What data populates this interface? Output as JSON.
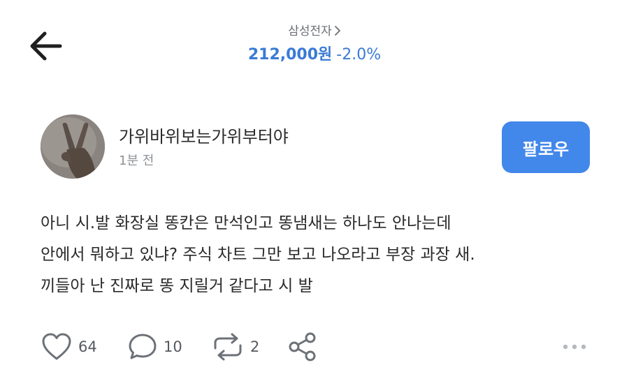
{
  "header": {
    "back_icon": "arrow-left-icon",
    "stock_name": "삼성전자",
    "stock_name_chevron": "chevron-right-icon",
    "price": "212,000원",
    "change": "-2.0%",
    "price_color": "#3a7bd5"
  },
  "post": {
    "author": "가위바위보는가위부터야",
    "time": "1분 전",
    "follow_label": "팔로우",
    "follow_color": "#4287ea",
    "body_lines": [
      "아니 시.발 화장실 똥칸은 만석인고 똥냄새는 하나도 안나는데",
      "안에서 뭐하고 있냐? 주식 차트 그만 보고 나오라고 부장 과장 새.",
      "끼들아 난 진짜로 똥 지릴거 같다고 시 발"
    ]
  },
  "actions": {
    "like": {
      "icon": "heart-icon",
      "count": "64"
    },
    "comment": {
      "icon": "comment-icon",
      "count": "10"
    },
    "repost": {
      "icon": "repost-icon",
      "count": "2"
    },
    "share": {
      "icon": "share-icon"
    },
    "more": {
      "icon": "more-dots-icon"
    }
  }
}
